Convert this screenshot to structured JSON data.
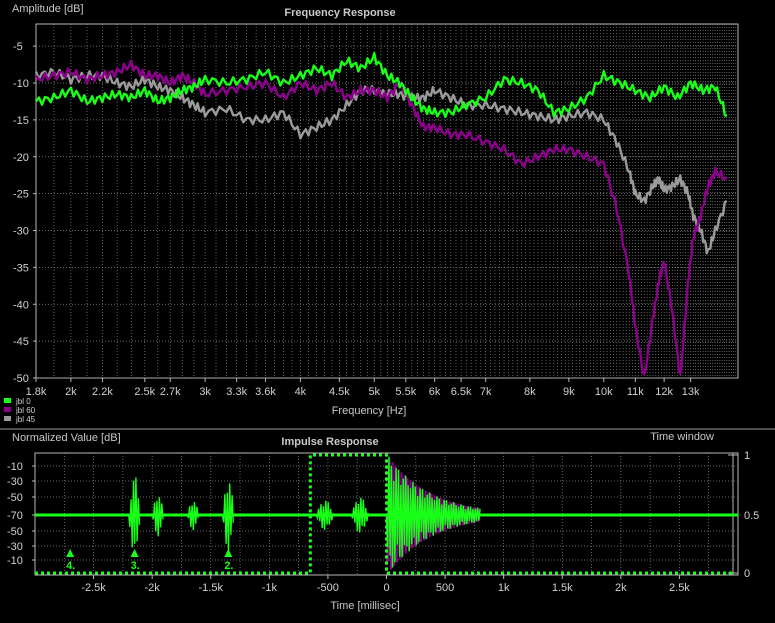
{
  "colors": {
    "background": "#000000",
    "grid": "#8a8a8a",
    "axis": "#b8b8b8",
    "text_light": "#d0d0d0",
    "green": "#18ff18",
    "purple": "#8c008c",
    "gray": "#9a9a9a"
  },
  "chart_data": [
    {
      "type": "line",
      "title": "Frequency Response",
      "xlabel": "Frequency [Hz]",
      "ylabel": "Amplitude [dB]",
      "xscale": "log",
      "xlim": [
        1800,
        15000
      ],
      "ylim": [
        -50,
        -2
      ],
      "grid": true,
      "x_tick_labels": [
        "1.8k",
        "2k",
        "2.2k",
        "2.5k",
        "2.7k",
        "3k",
        "3.3k",
        "3.6k",
        "4k",
        "4.5k",
        "5k",
        "5.5k",
        "6k",
        "6.5k",
        "7k",
        "8k",
        "9k",
        "10k",
        "11k",
        "12k",
        "13k"
      ],
      "x_ticks": [
        1800,
        2000,
        2200,
        2500,
        2700,
        3000,
        3300,
        3600,
        4000,
        4500,
        5000,
        5500,
        6000,
        6500,
        7000,
        8000,
        9000,
        10000,
        11000,
        12000,
        13000
      ],
      "y_ticks": [
        -5,
        -10,
        -15,
        -20,
        -25,
        -30,
        -35,
        -40,
        -45,
        -50
      ],
      "y_tick_labels": [
        "-5",
        "-10",
        "-15",
        "-20",
        "-25",
        "-30",
        "-35",
        "-40",
        "-45",
        "-50"
      ],
      "legend_position": "bottom-left",
      "series": [
        {
          "name": "jbl 0",
          "color": "#18ff18",
          "x": [
            1800,
            1900,
            2000,
            2100,
            2200,
            2300,
            2400,
            2500,
            2600,
            2700,
            2800,
            2900,
            3000,
            3200,
            3400,
            3600,
            3800,
            4000,
            4200,
            4400,
            4600,
            4800,
            5000,
            5200,
            5400,
            5600,
            5800,
            6000,
            6300,
            6600,
            7000,
            7400,
            7800,
            8200,
            8600,
            9000,
            9500,
            10000,
            10500,
            11000,
            11500,
            12000,
            12500,
            13000,
            13500,
            14000,
            14500
          ],
          "y": [
            -12.5,
            -12,
            -11,
            -12.5,
            -12,
            -11.5,
            -12,
            -11,
            -12.5,
            -12,
            -11,
            -10.5,
            -9.5,
            -10,
            -9.5,
            -8.5,
            -10,
            -9,
            -8,
            -9,
            -7,
            -8,
            -6.5,
            -9,
            -10,
            -12,
            -13.5,
            -14,
            -14,
            -13,
            -12,
            -9.5,
            -10,
            -11,
            -14,
            -13.5,
            -12,
            -9,
            -10,
            -11,
            -12,
            -10.5,
            -12,
            -10,
            -11,
            -10.5,
            -14.5
          ]
        },
        {
          "name": "jbl 60",
          "color": "#8c008c",
          "x": [
            1800,
            1900,
            2000,
            2100,
            2200,
            2300,
            2400,
            2500,
            2600,
            2700,
            2800,
            2900,
            3000,
            3200,
            3400,
            3600,
            3800,
            4000,
            4200,
            4400,
            4600,
            4800,
            5000,
            5200,
            5400,
            5600,
            5800,
            6000,
            6300,
            6600,
            7000,
            7400,
            7800,
            8200,
            8600,
            9000,
            9500,
            10000,
            10400,
            10800,
            11000,
            11300,
            11600,
            11800,
            12000,
            12300,
            12600,
            12900,
            13100,
            13400,
            13700,
            14000,
            14500
          ],
          "y": [
            -9.5,
            -9,
            -8.5,
            -9.5,
            -9,
            -8.5,
            -7.5,
            -9,
            -9,
            -10,
            -9,
            -10,
            -11.5,
            -11,
            -10.5,
            -10,
            -12,
            -10,
            -11,
            -10,
            -12,
            -11,
            -11,
            -12,
            -10,
            -13,
            -16,
            -16,
            -17,
            -17,
            -18,
            -19,
            -21,
            -20,
            -19,
            -19,
            -20,
            -21,
            -27,
            -36,
            -43,
            -50,
            -42,
            -37,
            -34,
            -41,
            -50,
            -37,
            -31,
            -28,
            -24,
            -22,
            -23
          ]
        },
        {
          "name": "jbl 45",
          "color": "#9a9a9a",
          "x": [
            1800,
            1900,
            2000,
            2100,
            2200,
            2300,
            2400,
            2500,
            2600,
            2700,
            2800,
            2900,
            3000,
            3200,
            3400,
            3600,
            3800,
            4000,
            4200,
            4400,
            4600,
            4800,
            5000,
            5200,
            5400,
            5600,
            5800,
            6000,
            6300,
            6600,
            7000,
            7400,
            7800,
            8200,
            8600,
            9000,
            9500,
            10000,
            10400,
            10800,
            11000,
            11300,
            11600,
            11800,
            12000,
            12300,
            12600,
            12900,
            13100,
            13400,
            13700,
            14000,
            14500
          ],
          "y": [
            -9,
            -8.5,
            -9.5,
            -9,
            -9,
            -10,
            -10.5,
            -9.5,
            -10.5,
            -11,
            -12,
            -13,
            -14,
            -13.5,
            -15,
            -15,
            -14,
            -17,
            -16,
            -15,
            -13,
            -11,
            -11,
            -11.5,
            -11.5,
            -12,
            -12,
            -11,
            -12,
            -13,
            -13,
            -13.5,
            -14,
            -14.5,
            -15,
            -14.5,
            -14,
            -15,
            -18,
            -22,
            -25,
            -26,
            -24,
            -23,
            -24.5,
            -24,
            -23,
            -25,
            -28,
            -30,
            -33,
            -30,
            -26
          ]
        }
      ]
    },
    {
      "type": "line",
      "title": "Impulse Response",
      "xlabel": "Time [millisec]",
      "ylabel": "Normalized Value [dB]",
      "y2label": "Time window",
      "xlim": [
        -3000,
        3000
      ],
      "x_ticks": [
        -2500,
        -2000,
        -1500,
        -1000,
        -500,
        0,
        500,
        1000,
        1500,
        2000,
        2500
      ],
      "x_tick_labels": [
        "-2.5k",
        "-2k",
        "-1.5k",
        "-1k",
        "-500",
        "0",
        "500",
        "1k",
        "1.5k",
        "2k",
        "2.5k"
      ],
      "y_tick_labels": [
        "-10",
        "-30",
        "-50",
        "-70",
        "-50",
        "-30",
        "-10"
      ],
      "y2_ticks": [
        1,
        0.5,
        0
      ],
      "y2_tick_labels": [
        "1",
        "0.5",
        "0"
      ],
      "grid": true,
      "markers": [
        {
          "label": "4.",
          "time": -2700
        },
        {
          "label": "3.",
          "time": -2150
        },
        {
          "label": "2.",
          "time": -1350
        }
      ],
      "time_window": {
        "start": -650,
        "end": 0,
        "level_high": 1,
        "level_low": 0
      },
      "series": [
        {
          "name": "jbl 0",
          "color": "#18ff18"
        },
        {
          "name": "jbl 60",
          "color": "#8c008c"
        }
      ],
      "bursts": [
        {
          "start": -2200,
          "end": -2100,
          "amp": 0.65
        },
        {
          "start": -2000,
          "end": -1900,
          "amp": 0.35
        },
        {
          "start": -1700,
          "end": -1600,
          "amp": 0.25
        },
        {
          "start": -1400,
          "end": -1300,
          "amp": 0.6
        },
        {
          "start": -600,
          "end": -450,
          "amp": 0.25
        },
        {
          "start": -300,
          "end": -150,
          "amp": 0.3
        },
        {
          "start": 0,
          "end": 800,
          "amp": 1.0
        }
      ]
    }
  ]
}
